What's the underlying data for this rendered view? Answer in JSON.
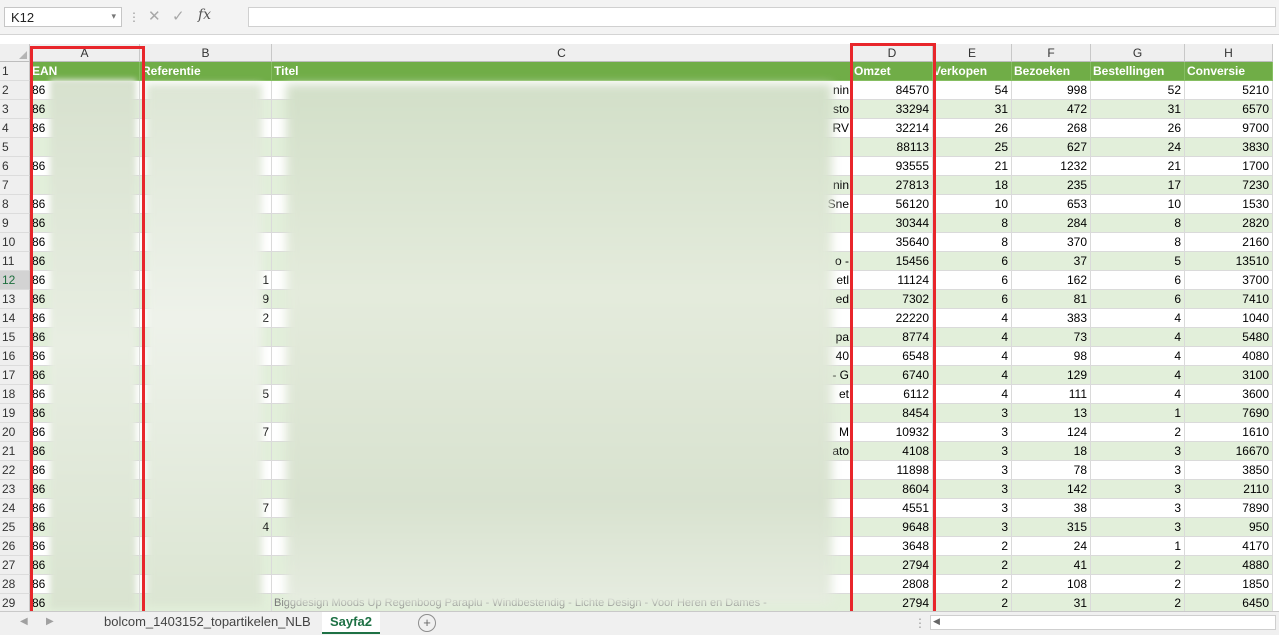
{
  "formula_bar": {
    "cell_ref": "K12",
    "dropdown_glyph": "▾",
    "separator_glyph": "⋮",
    "cancel_glyph": "✕",
    "confirm_glyph": "✓",
    "fx_label": "fx"
  },
  "columns": [
    {
      "letter": "A"
    },
    {
      "letter": "B"
    },
    {
      "letter": "C"
    },
    {
      "letter": "D"
    },
    {
      "letter": "E"
    },
    {
      "letter": "F"
    },
    {
      "letter": "G"
    },
    {
      "letter": "H"
    }
  ],
  "header_row": {
    "number": "1",
    "cells": [
      "EAN",
      "Referentie",
      "Titel",
      "Omzet",
      "Verkopen",
      "Bezoeken",
      "Bestellingen",
      "Conversie"
    ]
  },
  "rows": [
    {
      "n": "2",
      "a": "86",
      "b": "",
      "c": "",
      "c_tail": "nin",
      "omzet": "84570",
      "verkopen": "54",
      "bezoeken": "998",
      "bestellingen": "52",
      "conversie": "5210"
    },
    {
      "n": "3",
      "a": "86",
      "b": "",
      "c": "",
      "c_tail": "sto",
      "omzet": "33294",
      "verkopen": "31",
      "bezoeken": "472",
      "bestellingen": "31",
      "conversie": "6570"
    },
    {
      "n": "4",
      "a": "86",
      "b": "",
      "c": "",
      "c_tail": "RV",
      "omzet": "32214",
      "verkopen": "26",
      "bezoeken": "268",
      "bestellingen": "26",
      "conversie": "9700"
    },
    {
      "n": "5",
      "a": "",
      "b": "",
      "c": "",
      "c_tail": "",
      "omzet": "88113",
      "verkopen": "25",
      "bezoeken": "627",
      "bestellingen": "24",
      "conversie": "3830"
    },
    {
      "n": "6",
      "a": "86",
      "b": "",
      "c": "",
      "c_tail": "",
      "omzet": "93555",
      "verkopen": "21",
      "bezoeken": "1232",
      "bestellingen": "21",
      "conversie": "1700"
    },
    {
      "n": "7",
      "a": "",
      "b": "",
      "c": "",
      "c_tail": "nin",
      "omzet": "27813",
      "verkopen": "18",
      "bezoeken": "235",
      "bestellingen": "17",
      "conversie": "7230"
    },
    {
      "n": "8",
      "a": "86",
      "b": "",
      "c": "",
      "c_tail": "Sne",
      "omzet": "56120",
      "verkopen": "10",
      "bezoeken": "653",
      "bestellingen": "10",
      "conversie": "1530"
    },
    {
      "n": "9",
      "a": "86",
      "b": "",
      "c": "",
      "c_tail": "",
      "omzet": "30344",
      "verkopen": "8",
      "bezoeken": "284",
      "bestellingen": "8",
      "conversie": "2820"
    },
    {
      "n": "10",
      "a": "86",
      "b": "",
      "c": "",
      "c_tail": "",
      "omzet": "35640",
      "verkopen": "8",
      "bezoeken": "370",
      "bestellingen": "8",
      "conversie": "2160"
    },
    {
      "n": "11",
      "a": "86",
      "b": "",
      "c": "",
      "c_tail": "o -",
      "omzet": "15456",
      "verkopen": "6",
      "bezoeken": "37",
      "bestellingen": "5",
      "conversie": "13510"
    },
    {
      "n": "12",
      "a": "86",
      "b": "1",
      "c": "",
      "c_tail": "etl",
      "omzet": "11124",
      "verkopen": "6",
      "bezoeken": "162",
      "bestellingen": "6",
      "conversie": "3700"
    },
    {
      "n": "13",
      "a": "86",
      "b": "9",
      "c": "",
      "c_tail": "ed",
      "omzet": "7302",
      "verkopen": "6",
      "bezoeken": "81",
      "bestellingen": "6",
      "conversie": "7410"
    },
    {
      "n": "14",
      "a": "86",
      "b": "2",
      "c": "",
      "c_tail": "",
      "omzet": "22220",
      "verkopen": "4",
      "bezoeken": "383",
      "bestellingen": "4",
      "conversie": "1040"
    },
    {
      "n": "15",
      "a": "86",
      "b": "",
      "c": "",
      "c_tail": "pa",
      "omzet": "8774",
      "verkopen": "4",
      "bezoeken": "73",
      "bestellingen": "4",
      "conversie": "5480"
    },
    {
      "n": "16",
      "a": "86",
      "b": "",
      "c": "",
      "c_tail": "40",
      "omzet": "6548",
      "verkopen": "4",
      "bezoeken": "98",
      "bestellingen": "4",
      "conversie": "4080"
    },
    {
      "n": "17",
      "a": "86",
      "b": "",
      "c": "",
      "c_tail": "- G",
      "omzet": "6740",
      "verkopen": "4",
      "bezoeken": "129",
      "bestellingen": "4",
      "conversie": "3100"
    },
    {
      "n": "18",
      "a": "86",
      "b": "5",
      "c": "",
      "c_tail": "et",
      "omzet": "6112",
      "verkopen": "4",
      "bezoeken": "111",
      "bestellingen": "4",
      "conversie": "3600"
    },
    {
      "n": "19",
      "a": "86",
      "b": "",
      "c": "",
      "c_tail": "",
      "omzet": "8454",
      "verkopen": "3",
      "bezoeken": "13",
      "bestellingen": "1",
      "conversie": "7690"
    },
    {
      "n": "20",
      "a": "86",
      "b": "7",
      "c": "",
      "c_tail": "M",
      "omzet": "10932",
      "verkopen": "3",
      "bezoeken": "124",
      "bestellingen": "2",
      "conversie": "1610"
    },
    {
      "n": "21",
      "a": "86",
      "b": "",
      "c": "",
      "c_tail": "ato",
      "omzet": "4108",
      "verkopen": "3",
      "bezoeken": "18",
      "bestellingen": "3",
      "conversie": "16670"
    },
    {
      "n": "22",
      "a": "86",
      "b": "",
      "c": "",
      "c_tail": "",
      "omzet": "11898",
      "verkopen": "3",
      "bezoeken": "78",
      "bestellingen": "3",
      "conversie": "3850"
    },
    {
      "n": "23",
      "a": "86",
      "b": "",
      "c": "",
      "c_tail": "",
      "omzet": "8604",
      "verkopen": "3",
      "bezoeken": "142",
      "bestellingen": "3",
      "conversie": "2110"
    },
    {
      "n": "24",
      "a": "86",
      "b": "7",
      "c": "",
      "c_tail": "",
      "omzet": "4551",
      "verkopen": "3",
      "bezoeken": "38",
      "bestellingen": "3",
      "conversie": "7890"
    },
    {
      "n": "25",
      "a": "86",
      "b": "4",
      "c": "",
      "c_tail": "",
      "omzet": "9648",
      "verkopen": "3",
      "bezoeken": "315",
      "bestellingen": "3",
      "conversie": "950"
    },
    {
      "n": "26",
      "a": "86",
      "b": "",
      "c": "",
      "c_tail": "",
      "omzet": "3648",
      "verkopen": "2",
      "bezoeken": "24",
      "bestellingen": "1",
      "conversie": "4170"
    },
    {
      "n": "27",
      "a": "86",
      "b": "",
      "c": "",
      "c_tail": "",
      "omzet": "2794",
      "verkopen": "2",
      "bezoeken": "41",
      "bestellingen": "2",
      "conversie": "4880"
    },
    {
      "n": "28",
      "a": "86",
      "b": "",
      "c": "",
      "c_tail": "",
      "omzet": "2808",
      "verkopen": "2",
      "bezoeken": "108",
      "bestellingen": "2",
      "conversie": "1850"
    },
    {
      "n": "29",
      "a": "86",
      "b": "",
      "c": "Biggdesign Moods Up Regenboog Paraplu - Windbestendig - Lichte Design - Voor Heren en Dames -",
      "c_tail": "",
      "omzet": "2794",
      "verkopen": "2",
      "bezoeken": "31",
      "bestellingen": "2",
      "conversie": "6450"
    }
  ],
  "selected_row": "12",
  "sheet_tabs": {
    "prev_glyph": "◀",
    "next_glyph": "▶",
    "tabs": [
      {
        "label": "bolcom_1403152_topartikelen_NLB",
        "active": false
      },
      {
        "label": "Sayfa2",
        "active": true
      }
    ],
    "add_glyph": "+",
    "more_glyph": "⋮",
    "scroll_glyph": "◀"
  },
  "colors": {
    "header_green": "#70ad47",
    "band_green": "#e2efda",
    "highlight_red": "#e8262b",
    "active_tab_green": "#1e7145"
  }
}
